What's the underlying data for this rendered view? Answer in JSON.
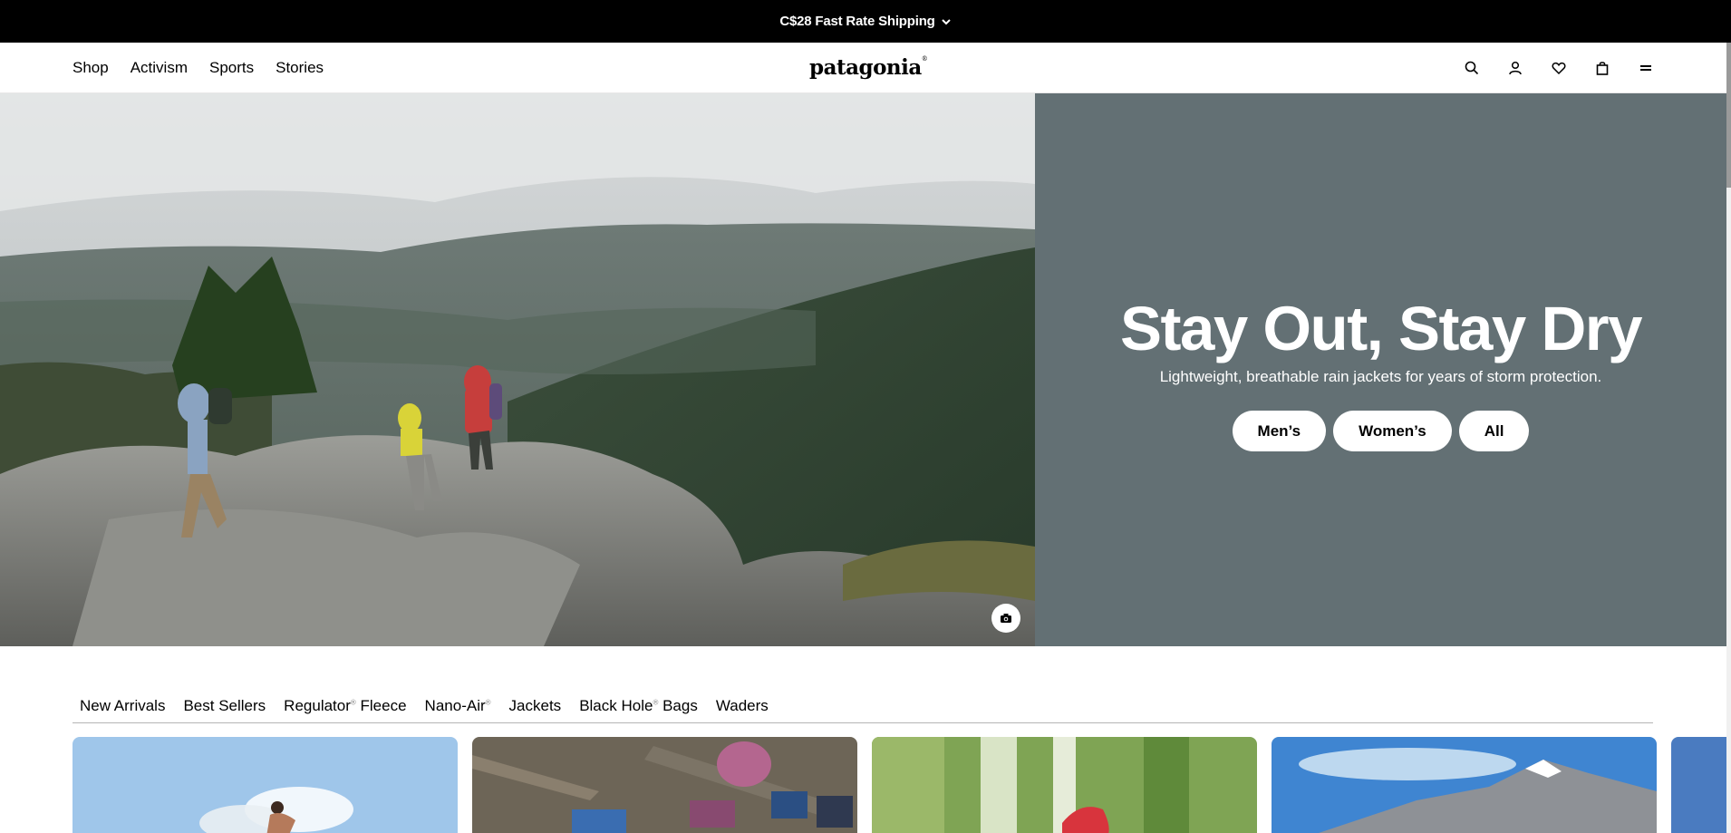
{
  "promo": {
    "text": "C$28 Fast Rate Shipping",
    "icon": "chevron-down-icon"
  },
  "header": {
    "nav": [
      "Shop",
      "Activism",
      "Sports",
      "Stories"
    ],
    "logo": "patagonia",
    "icons": [
      "search-icon",
      "account-icon",
      "wishlist-heart-icon",
      "cart-bag-icon",
      "menu-icon"
    ]
  },
  "hero": {
    "title": "Stay Out, Stay Dry",
    "subtitle": "Lightweight, breathable rain jackets for years of storm protection.",
    "buttons": [
      "Men’s",
      "Women’s",
      "All"
    ],
    "panel_color": "#637074",
    "photo_icon": "camera-icon"
  },
  "tabs": {
    "items": [
      {
        "label": "New Arrivals",
        "mark": ""
      },
      {
        "label": "Best Sellers",
        "mark": ""
      },
      {
        "label": "Regulator",
        "mark": "®",
        "suffix": " Fleece"
      },
      {
        "label": "Nano-Air",
        "mark": "®",
        "suffix": ""
      },
      {
        "label": "Jackets",
        "mark": ""
      },
      {
        "label": "Black Hole",
        "mark": "®",
        "suffix": " Bags"
      },
      {
        "label": "Waders",
        "mark": ""
      }
    ]
  },
  "cards": [
    "card-surf",
    "card-camp-gear",
    "card-bike",
    "card-mountain",
    "card-partial"
  ]
}
